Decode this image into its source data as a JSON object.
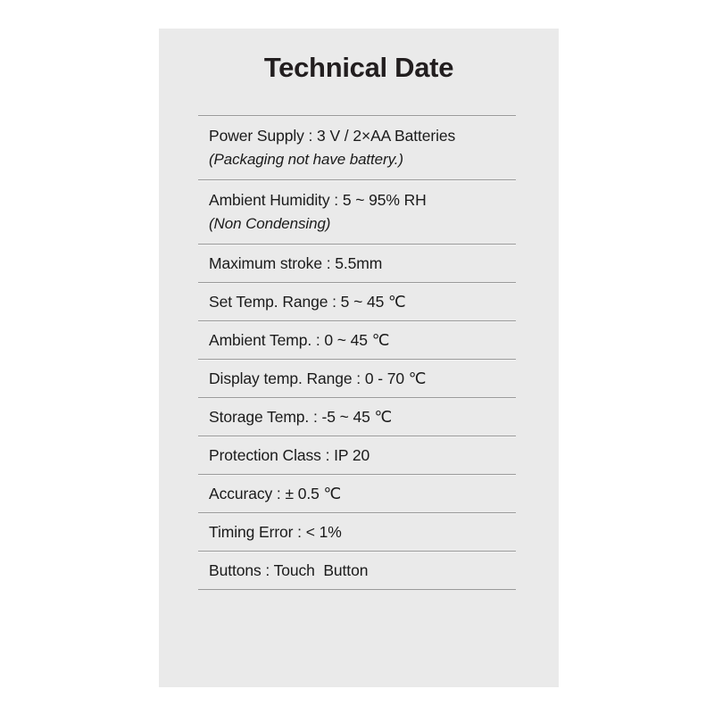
{
  "card": {
    "title": "Technical Date",
    "background_color": "#eaeaea",
    "text_color": "#1b1b1b",
    "divider_color": "#9a9a9a"
  },
  "specs": [
    {
      "text": "Power Supply : 3 V / 2×AA Batteries",
      "note": "(Packaging not have battery.)"
    },
    {
      "text": "Ambient Humidity : 5 ~ 95% RH",
      "note": "(Non Condensing)"
    },
    {
      "text": "Maximum stroke : 5.5mm",
      "note": ""
    },
    {
      "text": "Set Temp. Range : 5 ~ 45 ℃",
      "note": ""
    },
    {
      "text": "Ambient Temp. : 0 ~ 45 ℃",
      "note": ""
    },
    {
      "text": "Display temp. Range : 0 - 70 ℃",
      "note": ""
    },
    {
      "text": "Storage Temp. : -5 ~ 45 ℃",
      "note": ""
    },
    {
      "text": "Protection Class : IP 20",
      "note": ""
    },
    {
      "text": "Accuracy : ± 0.5 ℃",
      "note": ""
    },
    {
      "text": "Timing Error : < 1%",
      "note": ""
    },
    {
      "text": "Buttons : Touch  Button",
      "note": ""
    }
  ]
}
